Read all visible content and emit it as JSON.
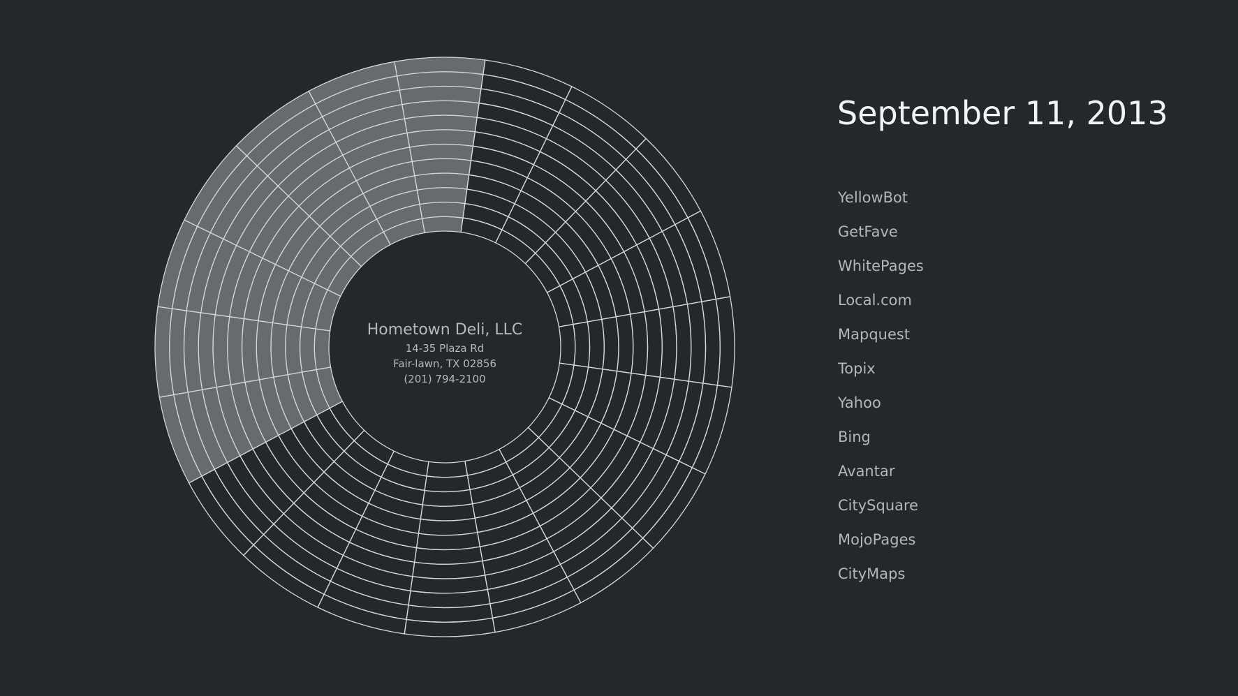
{
  "header": {
    "date": "September 11, 2013"
  },
  "business": {
    "name": "Hometown Deli, LLC",
    "street": "14-35 Plaza Rd",
    "city": "Fair-lawn, TX 02856",
    "phone": "(201) 794-2100"
  },
  "colors": {
    "background": "#24282b",
    "highlight_fill": "#686b6d",
    "grid_stroke": "#d4d7d9"
  },
  "chart_data": {
    "type": "radial-grid",
    "segments": 20,
    "rings": 12,
    "highlighted_segments": [
      0,
      14,
      15,
      16,
      17,
      18,
      19
    ]
  },
  "directories": [
    {
      "label": "YellowBot"
    },
    {
      "label": "GetFave"
    },
    {
      "label": "WhitePages"
    },
    {
      "label": "Local.com"
    },
    {
      "label": "Mapquest"
    },
    {
      "label": "Topix"
    },
    {
      "label": "Yahoo"
    },
    {
      "label": "Bing"
    },
    {
      "label": "Avantar"
    },
    {
      "label": "CitySquare"
    },
    {
      "label": "MojoPages"
    },
    {
      "label": "CityMaps"
    }
  ]
}
